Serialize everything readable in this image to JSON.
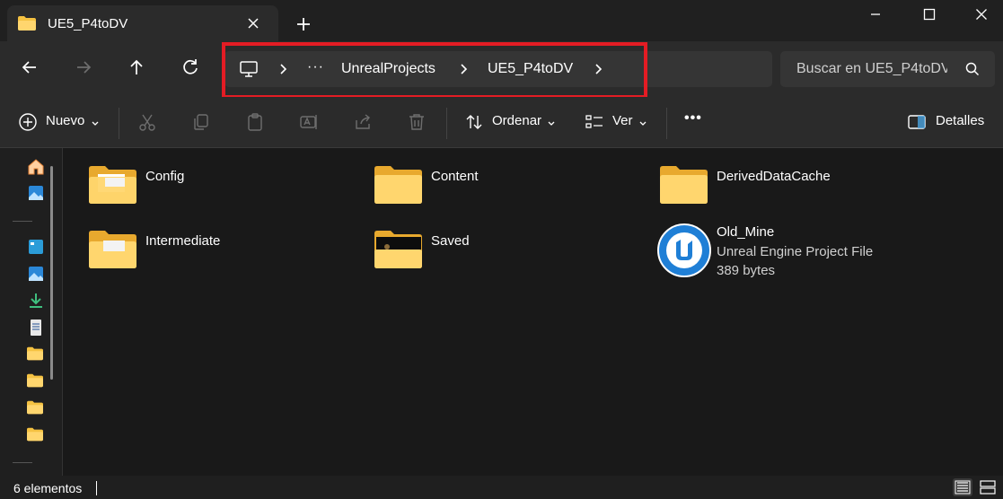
{
  "window": {
    "tab_title": "UE5_P4toDV"
  },
  "address": {
    "crumbs": [
      "UnrealProjects",
      "UE5_P4toDV"
    ],
    "ellipsis": "···"
  },
  "search": {
    "placeholder": "Buscar en UE5_P4toDV"
  },
  "toolbar": {
    "new_label": "Nuevo",
    "sort_label": "Ordenar",
    "view_label": "Ver",
    "more_label": "•••",
    "details_label": "Detalles"
  },
  "items": [
    {
      "name": "Config",
      "type": "folder"
    },
    {
      "name": "Content",
      "type": "folder"
    },
    {
      "name": "DerivedDataCache",
      "type": "folder"
    },
    {
      "name": "Intermediate",
      "type": "folder"
    },
    {
      "name": "Saved",
      "type": "folder"
    },
    {
      "name": "Old_Mine",
      "type": "Unreal Engine Project File",
      "size": "389 bytes"
    }
  ],
  "status": {
    "count": "6 elementos"
  },
  "colors": {
    "highlight": "#e41c24",
    "folder": "#f5c242",
    "unreal_badge": "#1f7fd6"
  }
}
